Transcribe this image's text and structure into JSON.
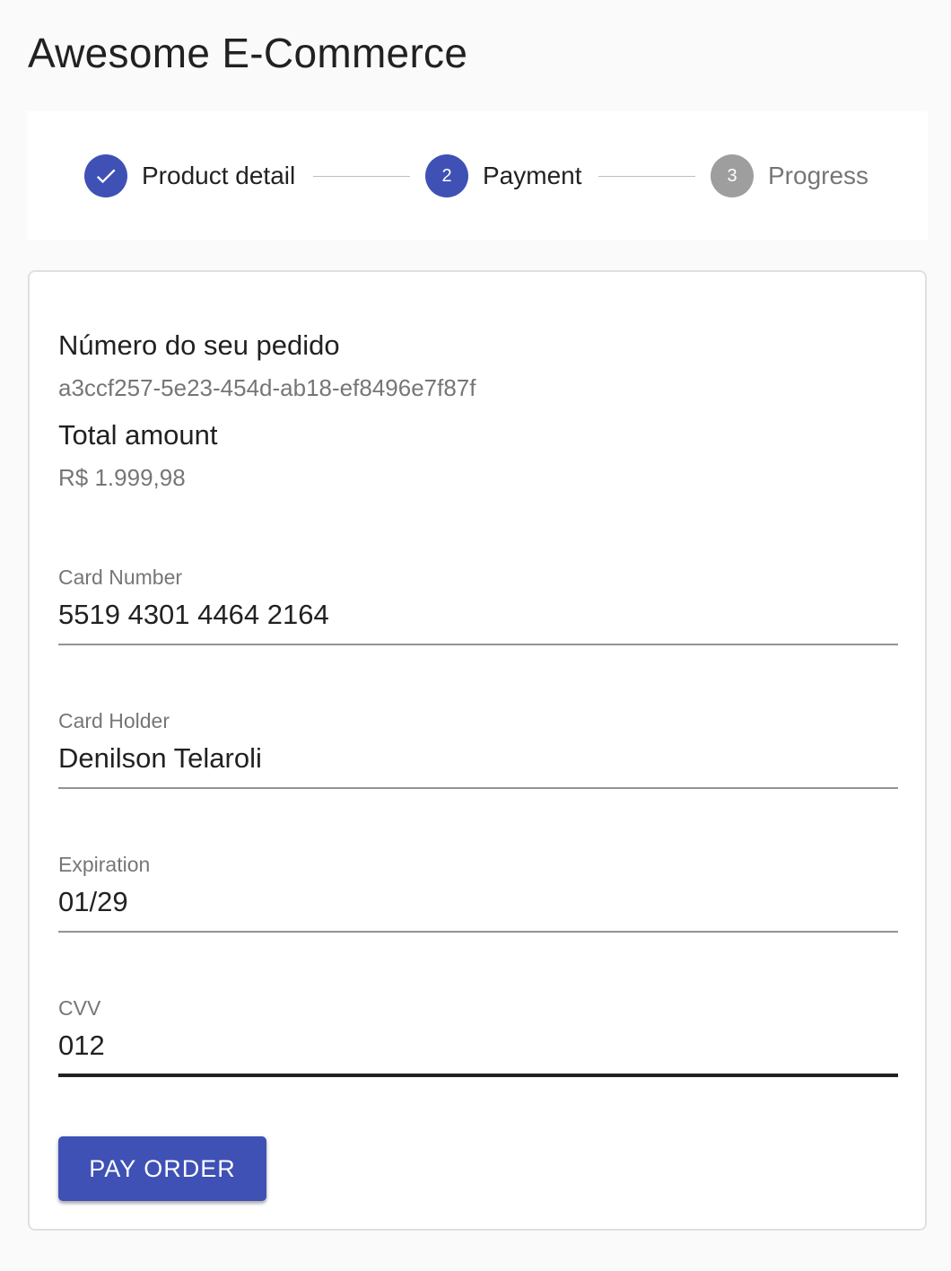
{
  "app": {
    "title": "Awesome E-Commerce"
  },
  "stepper": {
    "steps": [
      {
        "label": "Product detail",
        "number": "1",
        "state": "completed",
        "icon": "check-icon"
      },
      {
        "label": "Payment",
        "number": "2",
        "state": "active"
      },
      {
        "label": "Progress",
        "number": "3",
        "state": "pending"
      }
    ]
  },
  "order": {
    "number_title": "Número do seu pedido",
    "number_value": "a3ccf257-5e23-454d-ab18-ef8496e7f87f",
    "total_title": "Total amount",
    "total_value": "R$ 1.999,98"
  },
  "form": {
    "card_number": {
      "label": "Card Number",
      "value": "5519 4301 4464 2164"
    },
    "card_holder": {
      "label": "Card Holder",
      "value": "Denilson Telaroli"
    },
    "expiration": {
      "label": "Expiration",
      "value": "01/29"
    },
    "cvv": {
      "label": "CVV",
      "value": "012"
    }
  },
  "actions": {
    "pay_label": "PAY ORDER"
  },
  "colors": {
    "primary": "#3f51b5",
    "pending": "#9e9e9e",
    "background": "#fafafa"
  }
}
